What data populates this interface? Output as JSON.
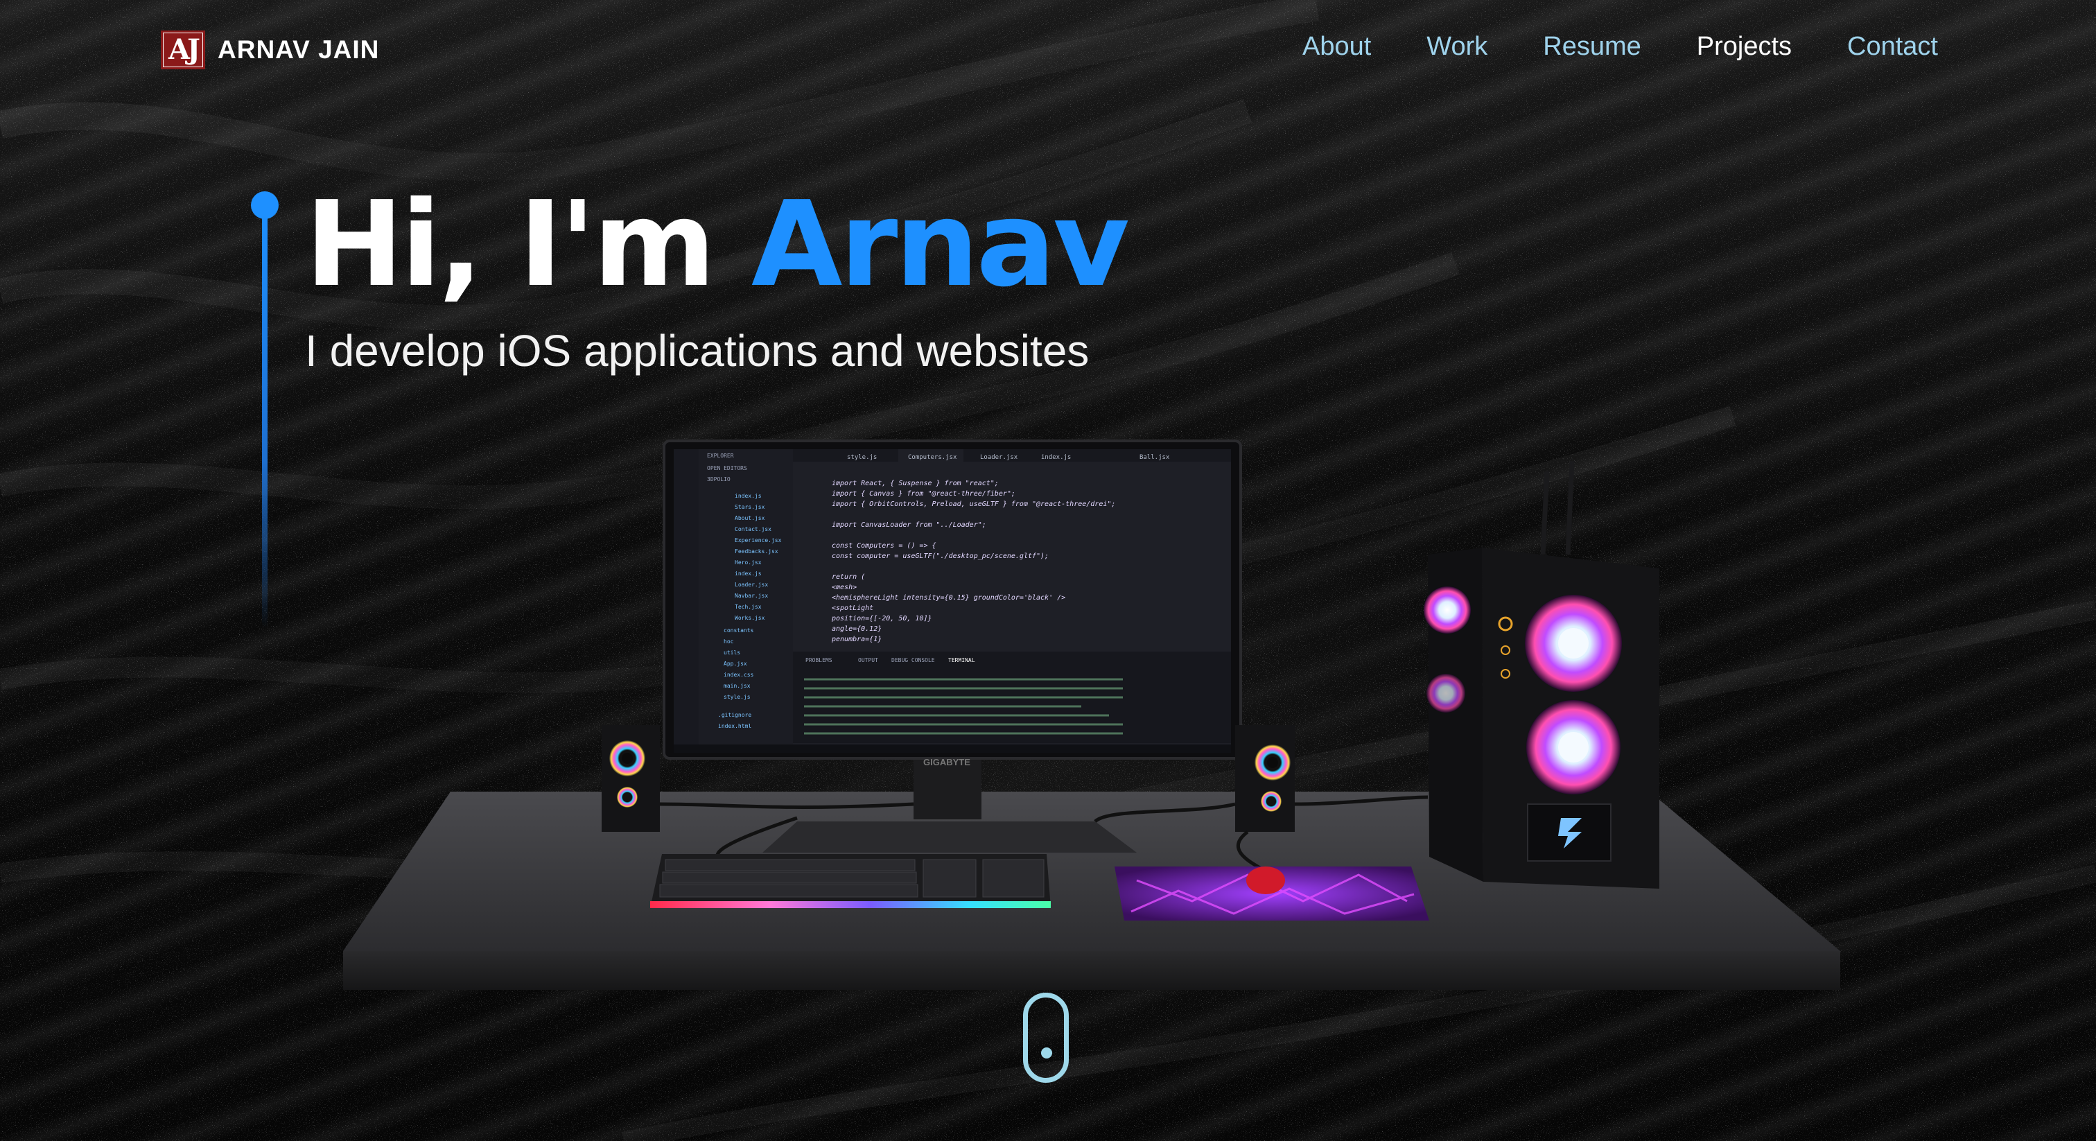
{
  "brand": {
    "logo_text": "AJ",
    "name": "ARNAV JAIN"
  },
  "nav": {
    "links": [
      {
        "label": "About"
      },
      {
        "label": "Work"
      },
      {
        "label": "Resume"
      },
      {
        "label": "Projects"
      },
      {
        "label": "Contact"
      }
    ]
  },
  "hero": {
    "greeting": "Hi, I'm ",
    "name": "Arnav",
    "subtitle": "I develop iOS applications and websites"
  },
  "scene": {
    "monitor_brand": "GIGABYTE",
    "editor": {
      "tabs": [
        "style.js",
        "Computers.jsx",
        "Loader.jsx",
        "index.js",
        "Ball.jsx"
      ],
      "code_lines": [
        "import React, { Suspense } from \"react\";",
        "import { Canvas } from \"@react-three/fiber\";",
        "import { OrbitControls, Preload, useGLTF } from \"@react-three/drei\";",
        "",
        "import CanvasLoader from \"../Loader\";",
        "",
        "const Computers = () => {",
        "  const computer = useGLTF(\"./desktop_pc/scene.gltf\");",
        "",
        "  return (",
        "    <mesh>",
        "      <hemisphereLight intensity={0.15} groundColor='black' />",
        "      <spotLight",
        "        position={[-20, 50, 10]}",
        "        angle={0.12}",
        "        penumbra={1}"
      ],
      "panel_tabs": [
        "PROBLEMS",
        "OUTPUT",
        "DEBUG CONSOLE",
        "TERMINAL"
      ]
    }
  },
  "colors": {
    "accent": "#1e90ff",
    "nav_link": "#9fd3ec",
    "nav_active": "#ffffff",
    "scroll_indicator": "#9ed8ea"
  },
  "icons": {
    "logo": "aj-monogram-icon",
    "scroll": "mouse-scroll-icon"
  }
}
